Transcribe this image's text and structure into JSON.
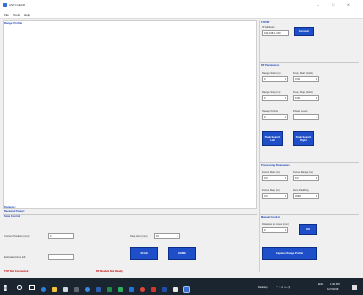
{
  "window": {
    "title": "ASTI GEAR",
    "minimize": "–",
    "maximize": "□",
    "close": "✕"
  },
  "menu": [
    "File",
    "Tools",
    "Help"
  ],
  "plot": {
    "title": "Range Profile",
    "distance_label": "Distance:",
    "received_power_label": "Received Power:"
  },
  "scan_control": {
    "title": "Scan Control",
    "current_position_label": "Current Position (mm)",
    "current_position_value": "0",
    "step_size_label": "Step size (mm)",
    "step_size_value": "10",
    "estimated_time_label": "Estimated time left",
    "estimated_time_value": "",
    "scan_button": "SCAN",
    "home_button": "HOME"
  },
  "status": {
    "tcp": "TCP Not Connected",
    "rf": "RF Module Not Ready"
  },
  "tcp_ip": {
    "title": "TCP/IP",
    "ip_label": "IP Address",
    "ip_value": "192.168.1.100",
    "connect_button": "Connect"
  },
  "rf_parameters": {
    "title": "RF Parameters",
    "range_start_label": "Range Start (m)",
    "range_start_value": "0",
    "freq_start_label": "Freq. Start (GHz)",
    "freq_start_value": "0.00",
    "range_stop_label": "Range Stop (m)",
    "range_stop_value": "0",
    "freq_stop_label": "Freq. Stop (GHz)",
    "freq_stop_value": "0.00",
    "sweep_points_label": "Sweep Points",
    "sweep_points_value": "0",
    "power_level_label": "Power Level",
    "power_level_value": "",
    "peak_left_button": "Peak Search Left",
    "peak_right_button": "Peak Search Right"
  },
  "processing_parameters": {
    "title": "Processing Parameters",
    "focus_start_label": "Focus Start (m)",
    "focus_start_value": "0.0",
    "focus_range_label": "Focus Range (m)",
    "focus_range_value": "0.0",
    "focus_step_label": "Focus Step (m)",
    "focus_step_value": "0.0",
    "zero_padding_label": "Zero Padding",
    "zero_padding_value": "2048"
  },
  "manual_control": {
    "title": "Manual Control",
    "distance_label": "Distance to move (mm)",
    "distance_value": "0",
    "go_button": "GO",
    "capture_button": "Capture Range Profile"
  },
  "taskbar": {
    "desktop_label": "Desktop",
    "lang": "ENG",
    "time": "1:40 PM",
    "date": "11/7/2018"
  }
}
